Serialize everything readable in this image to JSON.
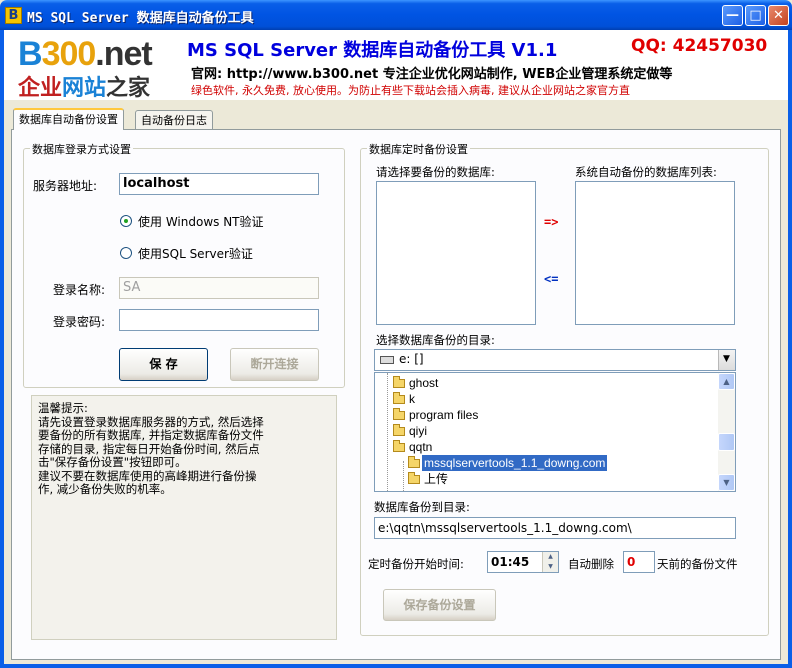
{
  "window": {
    "title": "MS SQL Server 数据库自动备份工具",
    "app_icon": "B"
  },
  "banner": {
    "logo_text": [
      "B",
      "300",
      ".net"
    ],
    "logo_cn": [
      "企业",
      "网站",
      "之家"
    ],
    "title": "MS SQL Server 数据库自动备份工具 V1.1",
    "qq": "QQ: 42457030",
    "site": "官网: http://www.b300.net 专注企业优化网站制作, WEB企业管理系统定做等",
    "warning": "绿色软件, 永久免费, 放心使用。为防止有些下载站会插入病毒, 建议从企业网站之家官方直"
  },
  "tabs": [
    "数据库自动备份设置",
    "自动备份日志"
  ],
  "login": {
    "group_title": "数据库登录方式设置",
    "server_label": "服务器地址:",
    "server_value": "localhost",
    "radio_nt": "使用 Windows NT验证",
    "radio_sql": "使用SQL Server验证",
    "user_label": "登录名称:",
    "user_value": "SA",
    "pass_label": "登录密码:",
    "pass_value": "",
    "save_button": "保 存",
    "disconnect_button": "断开连接"
  },
  "tip": {
    "lines": [
      "温馨提示:",
      "请先设置登录数据库服务器的方式, 然后选择",
      "要备份的所有数据库, 并指定数据库备份文件",
      "存储的目录, 指定每日开始备份时间, 然后点",
      "击\"保存备份设置\"按钮即可。",
      "建议不要在数据库使用的高峰期进行备份操",
      "作, 减少备份失败的机率。"
    ]
  },
  "schedule": {
    "group_title": "数据库定时备份设置",
    "select_db_label": "请选择要备份的数据库:",
    "auto_list_label": "系统自动备份的数据库列表:",
    "add_arrow": "=>",
    "remove_arrow": "<=",
    "dir_label": "选择数据库备份的目录:",
    "drive_value": "e: []",
    "tree": [
      {
        "label": "ghost",
        "level": 1,
        "selected": false
      },
      {
        "label": "k",
        "level": 1,
        "selected": false
      },
      {
        "label": "program files",
        "level": 1,
        "selected": false
      },
      {
        "label": "qiyi",
        "level": 1,
        "selected": false
      },
      {
        "label": "qqtn",
        "level": 1,
        "selected": false
      },
      {
        "label": "mssqlservertools_1.1_downg.com",
        "level": 2,
        "selected": true
      },
      {
        "label": "上传",
        "level": 2,
        "selected": false
      }
    ],
    "backup_to_label": "数据库备份到目录:",
    "backup_path": "e:\\qqtn\\mssqlservertools_1.1_downg.com\\",
    "start_time_label": "定时备份开始时间:",
    "start_time": "01:45",
    "auto_delete_label": "自动删除",
    "days_value": "0",
    "days_suffix": "天前的备份文件",
    "save_settings_button": "保存备份设置"
  }
}
